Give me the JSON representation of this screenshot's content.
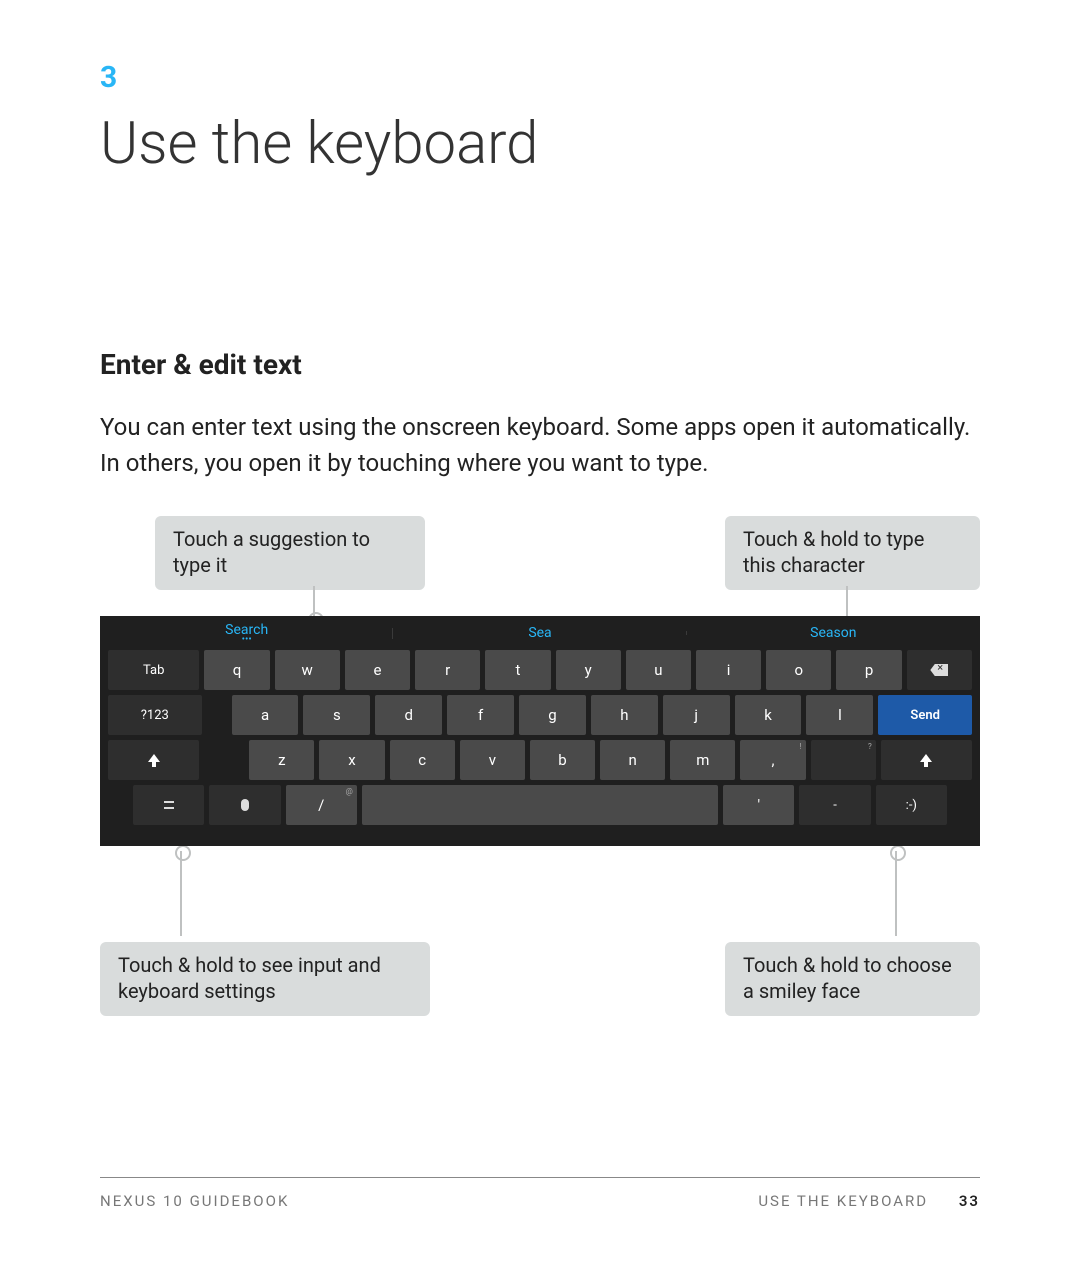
{
  "chapter": {
    "number": "3",
    "title": "Use the keyboard"
  },
  "section": {
    "heading": "Enter & edit text",
    "body": "You can enter text using the onscreen keyboard. Some apps open it automatically. In others, you open it by touching where you want to type."
  },
  "callouts": {
    "top_left": "Touch a suggestion to type it",
    "top_right": "Touch & hold to type this character",
    "bottom_left": "Touch & hold to see input and keyboard settings",
    "bottom_right": "Touch & hold to choose a smiley face"
  },
  "keyboard": {
    "suggestions": [
      "Search",
      "Sea",
      "Season"
    ],
    "row1_tab": "Tab",
    "row1": [
      "q",
      "w",
      "e",
      "r",
      "t",
      "y",
      "u",
      "i",
      "o",
      "p"
    ],
    "row2_sym": "?123",
    "row2": [
      "a",
      "s",
      "d",
      "f",
      "g",
      "h",
      "j",
      "k",
      "l"
    ],
    "row2_send": "Send",
    "row3": [
      "z",
      "x",
      "c",
      "v",
      "b",
      "n",
      "m",
      ","
    ],
    "row3_question_hint": "?",
    "row3_exclaim_hint": "!",
    "row4_slash": "/",
    "row4_slash_hint": "@",
    "row4_apostrophe": "'",
    "row4_dash": "-",
    "row4_smiley": ":-)"
  },
  "footer": {
    "left": "NEXUS 10 GUIDEBOOK",
    "right": "USE THE KEYBOARD",
    "page": "33"
  }
}
